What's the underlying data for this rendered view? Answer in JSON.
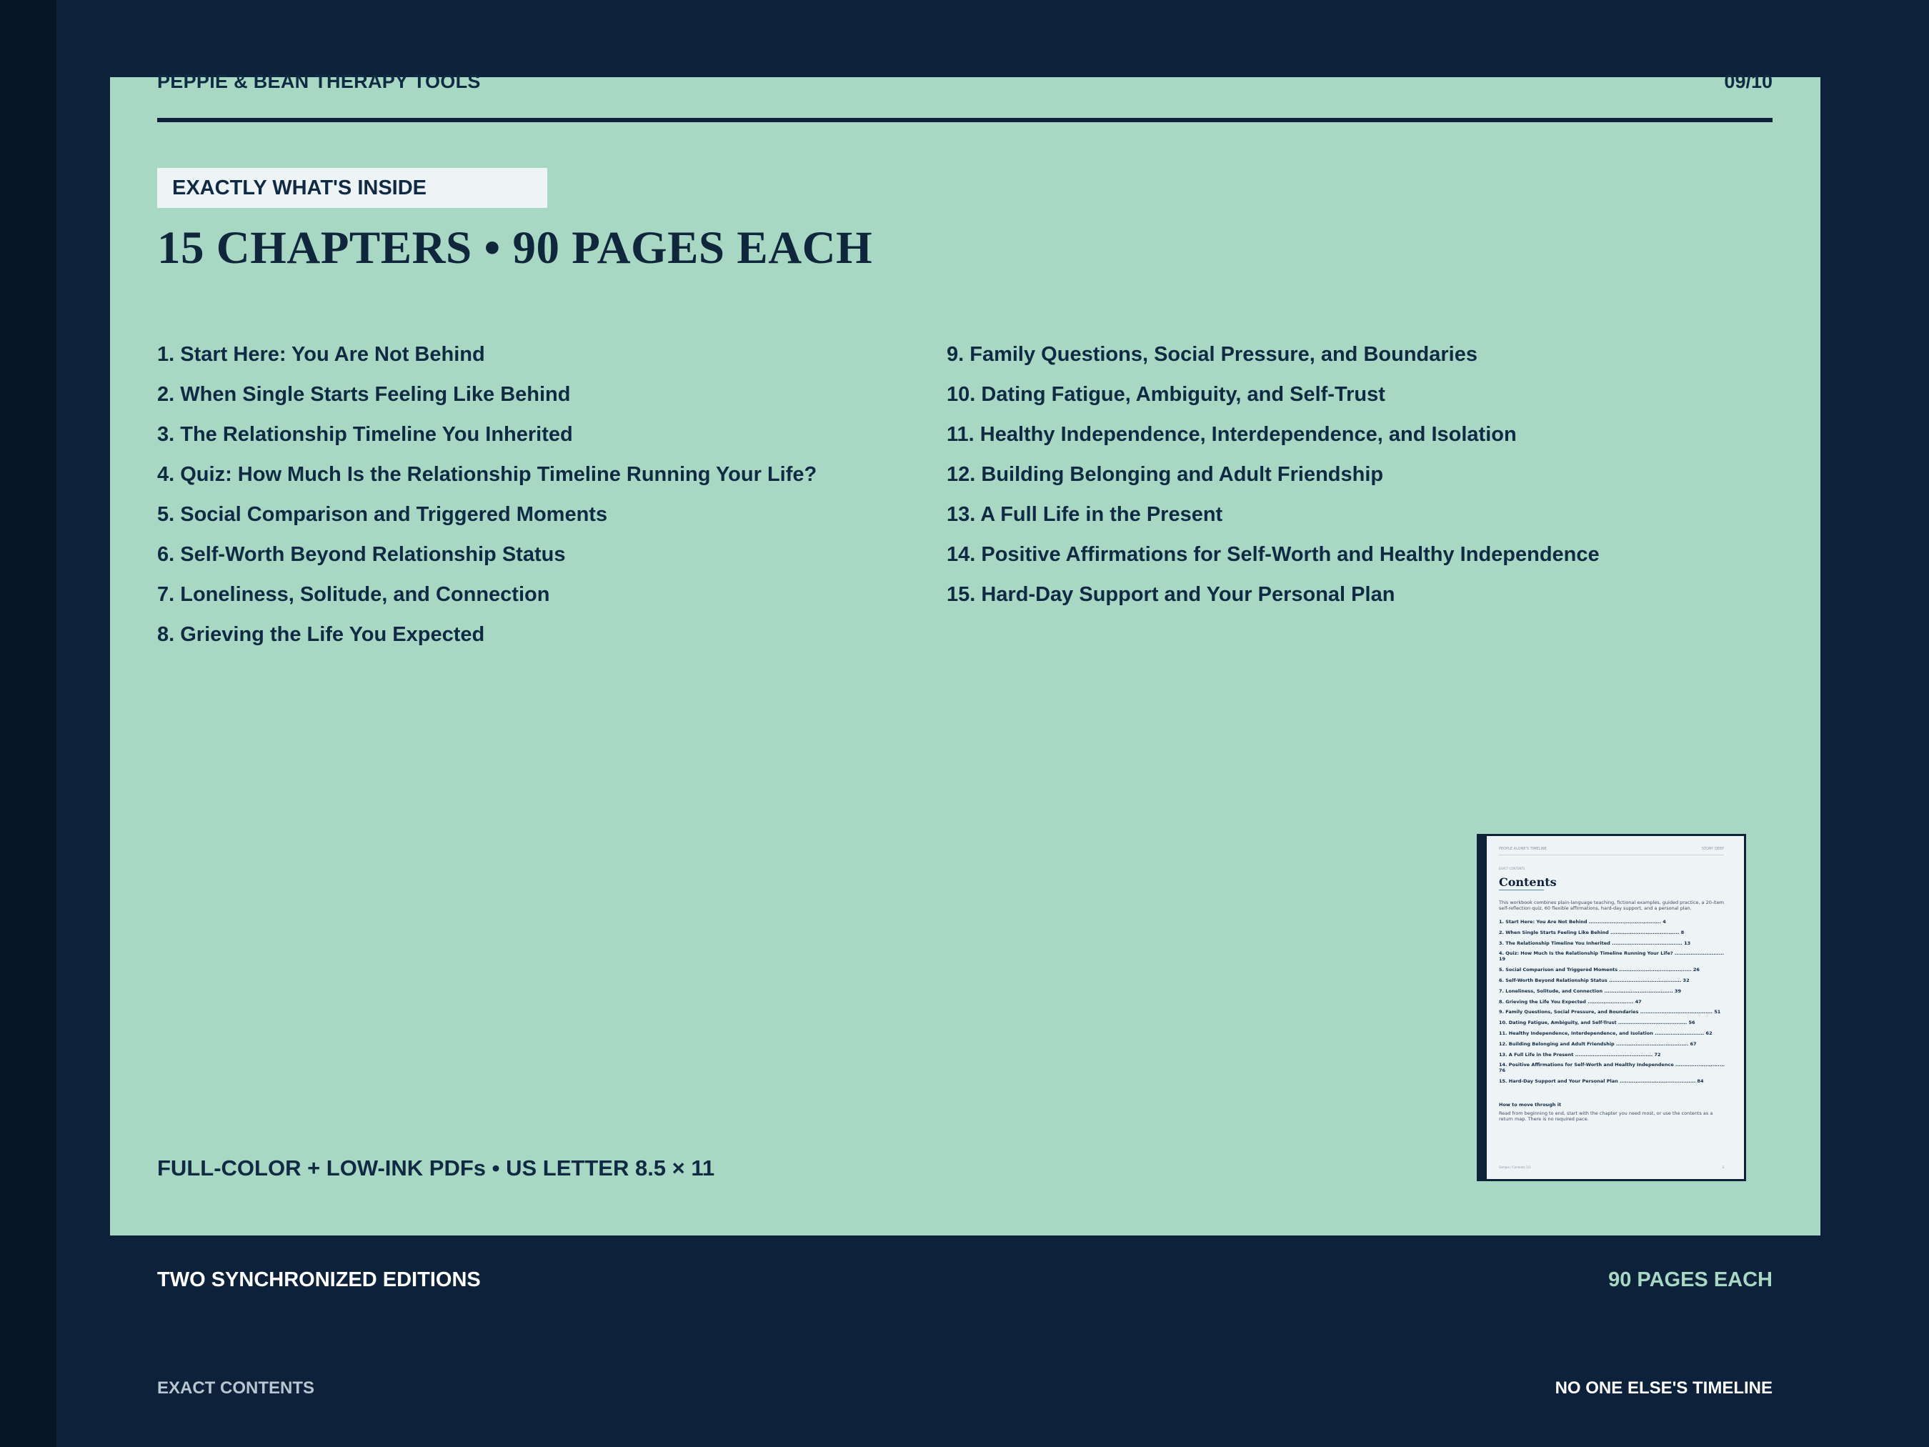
{
  "header": {
    "brand": "PEPPIE & BEAN THERAPY TOOLS",
    "page_number": "09/10"
  },
  "tag": "EXACTLY WHAT'S INSIDE",
  "headline": "15 CHAPTERS • 90 PAGES EACH",
  "chapters": [
    "1. Start Here: You Are Not Behind",
    "2. When Single Starts Feeling Like Behind",
    "3. The Relationship Timeline You Inherited",
    "4. Quiz: How Much Is the Relationship Timeline Running Your Life?",
    "5. Social Comparison and Triggered Moments",
    "6. Self-Worth Beyond Relationship Status",
    "7. Loneliness, Solitude, and Connection",
    "8. Grieving the Life You Expected",
    "9. Family Questions, Social Pressure, and Boundaries",
    "10. Dating Fatigue, Ambiguity, and Self-Trust",
    "11. Healthy Independence, Interdependence, and Isolation",
    "12. Building Belonging and Adult Friendship",
    "13. A Full Life in the Present",
    "14. Positive Affirmations for Self-Worth and Healthy Independence",
    "15. Hard-Day Support and Your Personal Plan"
  ],
  "formats": "FULL-COLOR + LOW-INK PDFs • US LETTER 8.5 × 11",
  "thumbnail": {
    "header_left": "PEOPLE ALONE'S TIMELINE",
    "header_right": "STORY DEEP",
    "eyebrow": "EXACT CONTENTS",
    "title": "Contents",
    "intro": "This workbook combines plain-language teaching, fictional examples, guided practice, a 20-item self-reflection quiz, 60 flexible affirmations, hard-day support, and a personal plan.",
    "entries": [
      "1. Start Here: You Are Not Behind ......................................... 4",
      "2. When Single Starts Feeling Like Behind ....................................... 8",
      "3. The Relationship Timeline You Inherited ........................................ 13",
      "4. Quiz: How Much Is the Relationship Timeline Running Your Life? ............................ 19",
      "5. Social Comparison and Triggered Moments ......................................... 26",
      "6. Self-Worth Beyond Relationship Status ......................................... 32",
      "7. Loneliness, Solitude, and Connection ....................................... 39",
      "8. Grieving the Life You Expected .......................... 47",
      "9. Family Questions, Social Pressure, and Boundaries ......................................... 51",
      "10. Dating Fatigue, Ambiguity, and Self-Trust ....................................... 56",
      "11. Healthy Independence, Interdependence, and Isolation ............................ 62",
      "12. Building Belonging and Adult Friendship ......................................... 67",
      "13. A Full Life in the Present ............................................ 72",
      "14. Positive Affirmations for Self-Worth and Healthy Independence ............................ 76",
      "15. Hard-Day Support and Your Personal Plan ........................................... 84"
    ],
    "subhead": "How to move through it",
    "subtext": "Read from beginning to end, start with the chapter you need most, or use the contents as a return map. There is no required pace.",
    "footer_left": "Sample / Contents 1/1",
    "footer_right": "3"
  },
  "band": {
    "left": "TWO SYNCHRONIZED EDITIONS",
    "right": "90 PAGES EACH"
  },
  "footer": {
    "left": "EXACT CONTENTS",
    "right": "NO ONE ELSE'S TIMELINE"
  },
  "colors": {
    "navy": "#0d223a",
    "mint": "#a8d8c3",
    "paper": "#eef3f6"
  }
}
